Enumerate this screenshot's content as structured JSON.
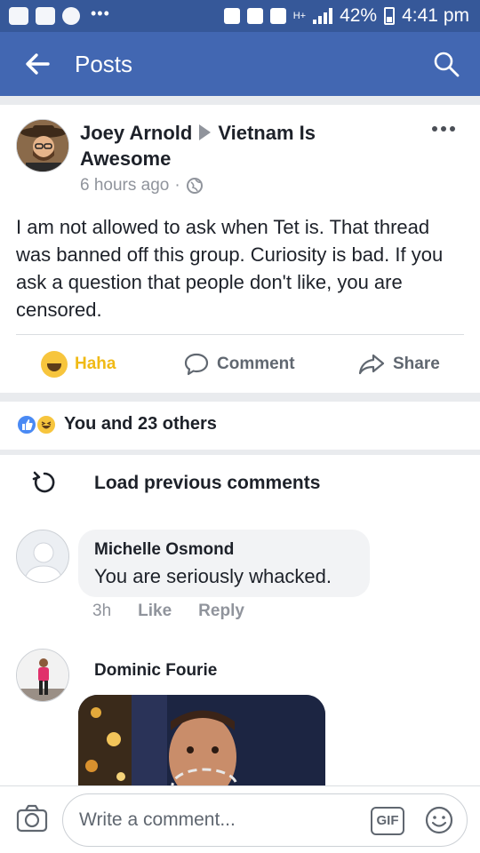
{
  "status_bar": {
    "battery": "42%",
    "time": "4:41 pm",
    "network": "H+",
    "dots": "•••"
  },
  "header": {
    "title": "Posts"
  },
  "post": {
    "author": "Joey Arnold",
    "group": "Vietnam Is Awesome",
    "time": "6 hours ago",
    "separator": "·",
    "text": "I am not allowed to ask when Tet is. That thread was banned off this group. Curiosity is bad. If you ask a question that people don't like, you are censored."
  },
  "actions": {
    "haha": "Haha",
    "comment": "Comment",
    "share": "Share"
  },
  "reactions": {
    "summary": "You and 23 others"
  },
  "comments": {
    "load_previous": "Load previous comments",
    "items": [
      {
        "name": "Michelle Osmond",
        "text": "You are seriously whacked.",
        "time": "3h",
        "like": "Like",
        "reply": "Reply"
      },
      {
        "name": "Dominic Fourie"
      }
    ]
  },
  "composer": {
    "placeholder": "Write a comment...",
    "gif_label": "GIF"
  },
  "colors": {
    "status_bar": "#365899",
    "header": "#4267b2",
    "haha": "#f0ba15",
    "like_blue": "#4a8af4"
  }
}
